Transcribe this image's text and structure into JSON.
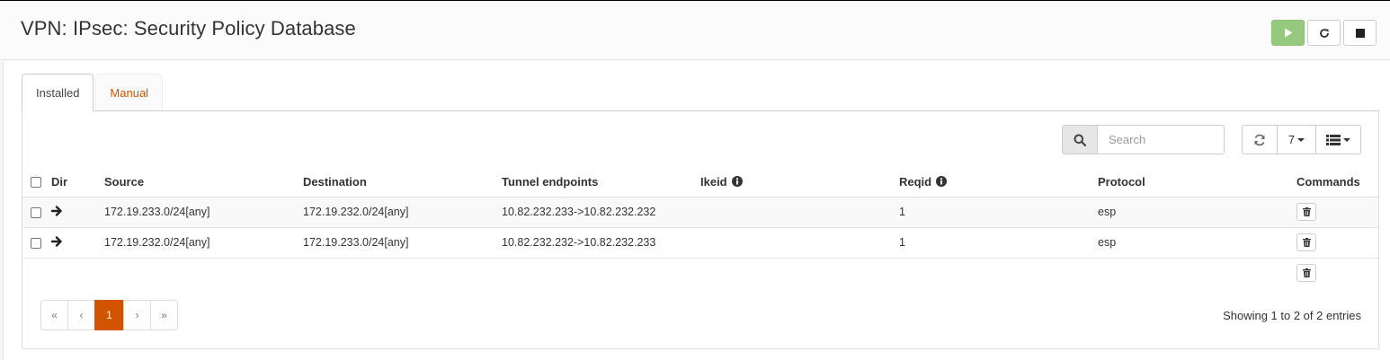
{
  "header": {
    "title": "VPN: IPsec: Security Policy Database"
  },
  "service_buttons": [
    "play-icon",
    "restart-icon",
    "stop-icon"
  ],
  "tabs": [
    {
      "label": "Installed",
      "active": true
    },
    {
      "label": "Manual",
      "active": false
    }
  ],
  "toolbar": {
    "search_placeholder": "Search",
    "rows_per_page": "7"
  },
  "table": {
    "columns": [
      "Dir",
      "Source",
      "Destination",
      "Tunnel endpoints",
      "Ikeid",
      "Reqid",
      "Protocol",
      "Commands"
    ],
    "rows": [
      {
        "dir": "arrow-right-icon",
        "source": "172.19.233.0/24[any]",
        "destination": "172.19.232.0/24[any]",
        "tunnel": "10.82.232.233->10.82.232.232",
        "ikeid": "",
        "reqid": "1",
        "protocol": "esp"
      },
      {
        "dir": "arrow-right-icon",
        "source": "172.19.232.0/24[any]",
        "destination": "172.19.233.0/24[any]",
        "tunnel": "10.82.232.232->10.82.232.233",
        "ikeid": "",
        "reqid": "1",
        "protocol": "esp"
      }
    ]
  },
  "pagination": {
    "first": "«",
    "prev": "‹",
    "current": "1",
    "next": "›",
    "last": "»",
    "info": "Showing 1 to 2 of 2 entries"
  },
  "colors": {
    "accent": "#d35400",
    "play_button": "#95c97f"
  }
}
